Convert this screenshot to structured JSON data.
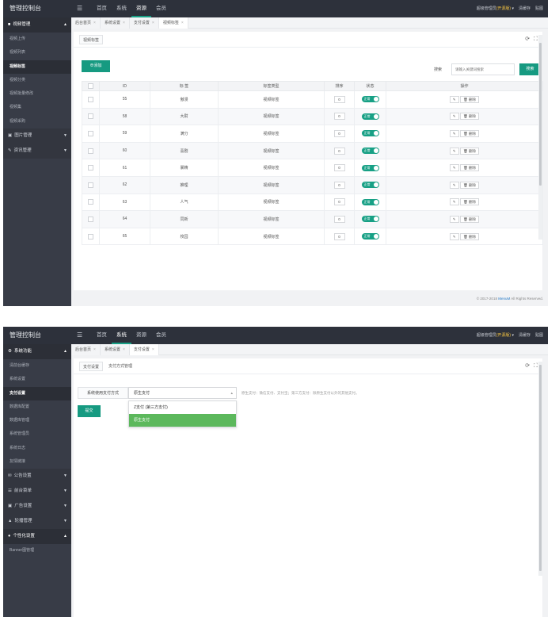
{
  "brand": "管理控制台",
  "menu_toggle_icon": "☰",
  "topnav": [
    "首页",
    "系统",
    "资源",
    "会员"
  ],
  "topright": {
    "admin": "超级管理员",
    "version": "(开源版)",
    "cache": "清缓存",
    "logout": "贴图"
  },
  "screen1": {
    "sidebar": {
      "group_open": "视频管理",
      "items": [
        "视频上传",
        "视频列表",
        "视频标签",
        "视频分类",
        "视频批量修改",
        "视频集",
        "视频采购"
      ],
      "groups_closed": [
        "图片管理",
        "资讯管理"
      ]
    },
    "tabs": [
      "后台首页",
      "系统设置",
      "支付设置",
      "视频标签"
    ],
    "panel_tab": "视频标签",
    "add_button": "⊕添加",
    "search_label": "搜索",
    "search_placeholder": "请输入关键词搜索",
    "search_button": "搜索",
    "columns": [
      "ID",
      "标 签",
      "标签类型",
      "排序",
      "状态",
      "操作"
    ],
    "rows": [
      {
        "id": "55",
        "label": "傲漫",
        "type": "视频标签",
        "sort": "0"
      },
      {
        "id": "58",
        "label": "大尉",
        "type": "视频标签",
        "sort": "0"
      },
      {
        "id": "59",
        "label": "满分",
        "type": "视频标签",
        "sort": "0"
      },
      {
        "id": "60",
        "label": "喜剧",
        "type": "视频标签",
        "sort": "0"
      },
      {
        "id": "61",
        "label": "暴精",
        "type": "视频标签",
        "sort": "0"
      },
      {
        "id": "62",
        "label": "推理",
        "type": "视频标签",
        "sort": "0"
      },
      {
        "id": "63",
        "label": "人气",
        "type": "视频标签",
        "sort": "0"
      },
      {
        "id": "64",
        "label": "同新",
        "type": "视频标签",
        "sort": "0"
      },
      {
        "id": "65",
        "label": "校园",
        "type": "视频标签",
        "sort": "0"
      }
    ],
    "status_label": "正常",
    "edit_icon": "✎",
    "delete_label": "🗑 删除",
    "footer_text": "© 2017-2018 ",
    "footer_link": "MenuM",
    "footer_rights": " All Rights Reserved."
  },
  "screen2": {
    "sidebar": {
      "group_open": "系统功能",
      "items": [
        "清前台缓存",
        "系统设置",
        "支付设置",
        "数据库配置",
        "数据库管理",
        "系统管理员",
        "系统日志",
        "友情链接"
      ],
      "groups_closed": [
        "公告设置",
        "前台菜单",
        "广告设置",
        "轮播管理"
      ],
      "group_open2": "个性化设置",
      "items2": [
        "Banner图管理"
      ]
    },
    "tabs": [
      "后台首页",
      "系统设置",
      "支付设置"
    ],
    "panel_tabs": [
      "支付设置",
      "支付方式管理"
    ],
    "form_label": "系统使用支付方式",
    "select_value": "原生支付",
    "hint": "原生支付：微信支付、支付宝；第三方支付：除原生支付以外的其他支付。",
    "submit": "提交",
    "options": [
      "Z支付 (第三方支付)",
      "原生支付"
    ]
  },
  "colors": {
    "accent": "#169a81",
    "topbar": "#2d313b",
    "sidebar": "#383c47",
    "selected_option": "#5cb85c"
  }
}
